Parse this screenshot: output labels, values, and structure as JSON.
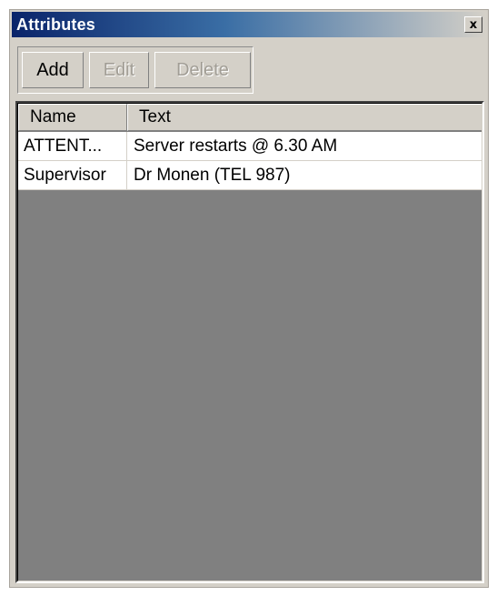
{
  "window": {
    "title": "Attributes",
    "close_glyph": "x"
  },
  "toolbar": {
    "add_label": "Add",
    "edit_label": "Edit",
    "delete_label": "Delete",
    "edit_enabled": false,
    "delete_enabled": false
  },
  "table": {
    "columns": [
      "Name",
      "Text"
    ],
    "rows": [
      {
        "name": "ATTENT...",
        "text": "Server restarts @ 6.30 AM"
      },
      {
        "name": "Supervisor",
        "text": "Dr Monen (TEL 987)"
      }
    ]
  },
  "colors": {
    "titlebar_start": "#0a246a",
    "titlebar_end": "#d4d0c8",
    "panel_bg": "#d4d0c8",
    "list_bg": "#808080",
    "row_bg": "#ffffff"
  },
  "icons": {
    "close": "close-icon"
  }
}
